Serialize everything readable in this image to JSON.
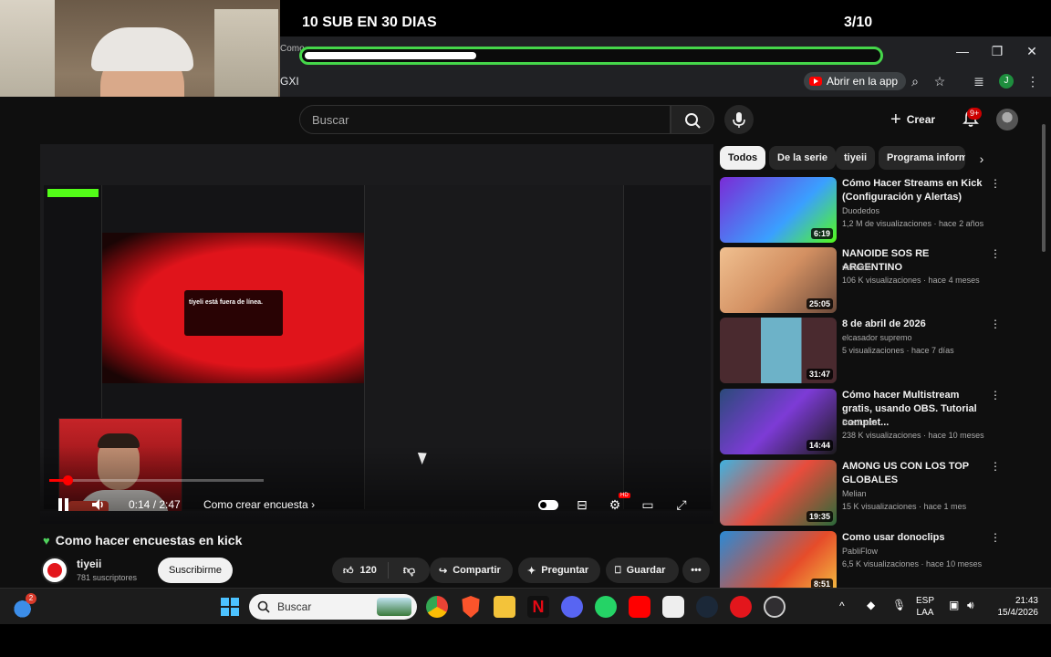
{
  "overlay": {
    "goal_title": "10 SUB EN 30 DIAS",
    "goal_count": "3/10",
    "goal_progress": 0.3
  },
  "browser": {
    "tab_partial": "Como",
    "address_left": "GXI",
    "open_app_label": "Abrir en la app",
    "profile_initial": "J"
  },
  "youtube": {
    "search_placeholder": "Buscar",
    "create_label": "Crear",
    "notif_badge": "9+",
    "player": {
      "offline_text": "tiyeli está fuera de línea.",
      "time": "0:14 / 2:47",
      "chapter": "Como crear encuesta",
      "progress": 0.085
    },
    "video": {
      "title": "Como hacer encuestas en kick",
      "channel": "tiyeii",
      "subscribers": "781 suscriptores",
      "subscribe_label": "Suscribirme",
      "likes": "120",
      "share_label": "Compartir",
      "ask_label": "Preguntar",
      "save_label": "Guardar"
    },
    "chips": [
      "Todos",
      "De la serie",
      "tiyeii",
      "Programa inform"
    ],
    "recommendations": [
      {
        "title": "Cómo Hacer Streams en Kick (Configuración y Alertas)",
        "channel": "Duodedos",
        "meta": "1,2 M de visualizaciones · hace 2 años",
        "duration": "6:19"
      },
      {
        "title": "NANOIDE SOS RE ARGENTINO",
        "channel": "nanoide",
        "meta": "106 K visualizaciones · hace 4 meses",
        "duration": "25:05"
      },
      {
        "title": "8 de abril de 2026",
        "channel": "elcasador supremo",
        "meta": "5 visualizaciones · hace 7 días",
        "duration": "31:47"
      },
      {
        "title": "Cómo hacer Multistream gratis, usando OBS. Tutorial complet...",
        "channel": "PredLabs",
        "meta": "238 K visualizaciones · hace 10 meses",
        "duration": "14:44"
      },
      {
        "title": "AMONG US CON LOS TOP GLOBALES",
        "channel": "Melian",
        "meta": "15 K visualizaciones · hace 1 mes",
        "duration": "19:35"
      },
      {
        "title": "Como usar donoclips",
        "channel": "PabliFlow",
        "meta": "6,5 K visualizaciones · hace 10 meses",
        "duration": "8:51"
      }
    ]
  },
  "taskbar": {
    "search_placeholder": "Buscar",
    "weather_badge": "2",
    "lang_line1": "ESP",
    "lang_line2": "LAA",
    "time": "21:43",
    "date": "15/4/2026"
  },
  "colors": {
    "goal_green": "#45d64a",
    "yt_red": "#ff0000",
    "kick_green": "#53fc18"
  }
}
